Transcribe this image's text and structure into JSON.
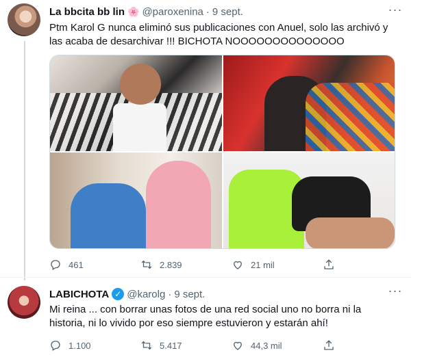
{
  "tweets": [
    {
      "name": "La bbcita bb lin",
      "name_emoji": "🌸",
      "handle": "@paroxenina",
      "dot": "·",
      "date": "9 sept.",
      "text": "Ptm Karol G nunca eliminó sus publicaciones con Anuel, solo las archivó y las acaba de desarchivar !!! BICHOTA NOOOOOOOOOOOOOO",
      "more": "···",
      "replies": "461",
      "retweets": "2.839",
      "likes": "21 mil"
    },
    {
      "name": "LABICHOTA",
      "verified": "✓",
      "handle": "@karolg",
      "dot": "·",
      "date": "9 sept.",
      "text": "Mi reina ... con borrar unas fotos de una red social uno no borra ni la historia, ni lo vivido por eso siempre estuvieron y estarán ahí!",
      "more": "···",
      "replies": "1.100",
      "retweets": "5.417",
      "likes": "44,3 mil"
    }
  ],
  "icons": {
    "reply": "reply-icon",
    "retweet": "retweet-icon",
    "like": "heart-icon",
    "share": "share-icon"
  },
  "colors": {
    "text": "#0f1419",
    "secondary": "#536471",
    "accent": "#1d9bf0",
    "border": "#cfd9de"
  }
}
